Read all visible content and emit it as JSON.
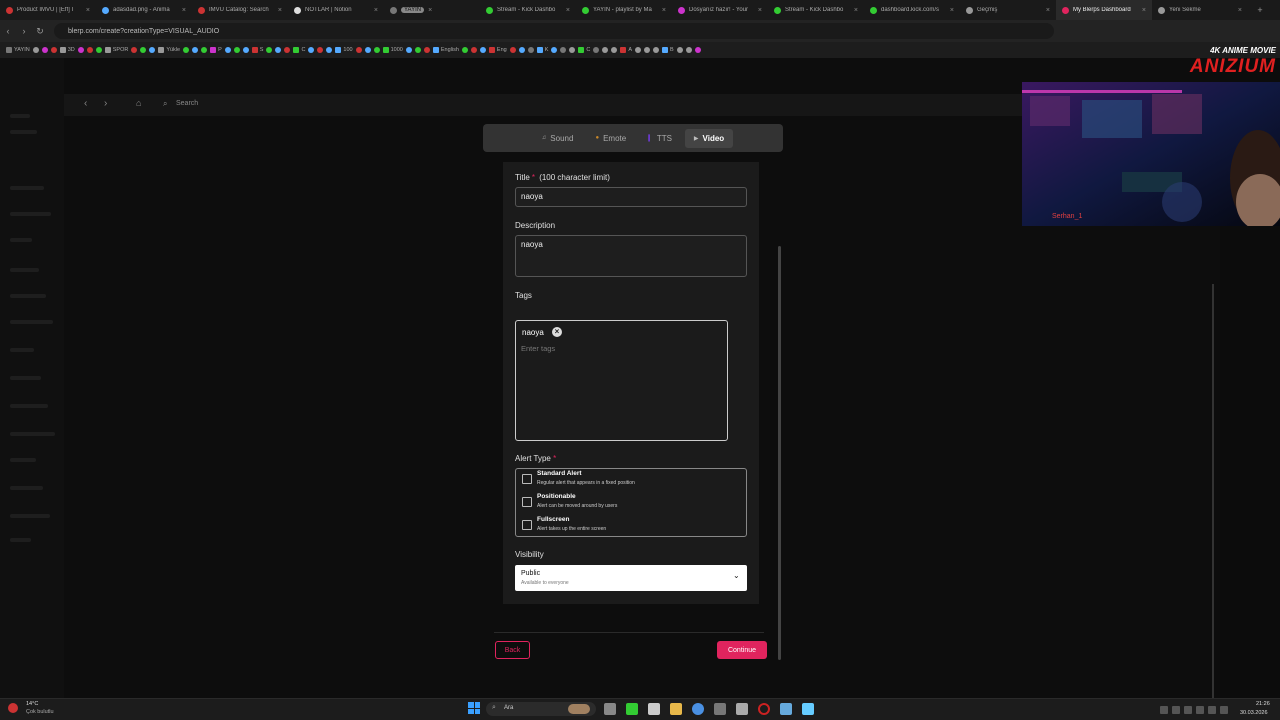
{
  "browser": {
    "tabs": [
      {
        "title": "Product IMVU | [Eff] I",
        "color": "#c33",
        "active": false
      },
      {
        "title": "adasdad.png - Anima",
        "color": "#5af",
        "active": false
      },
      {
        "title": "IMVU Catalog: Search",
        "color": "#c33",
        "active": false
      },
      {
        "title": "NOTLAR | Notion",
        "color": "#ddd",
        "active": false
      },
      {
        "title": "YAYIN",
        "color": "#777",
        "active": false,
        "badge": true
      },
      {
        "title": "Stream - Kick Dashbo",
        "color": "#3c3",
        "active": false
      },
      {
        "title": "YAYIN - playlist by Ma",
        "color": "#3c3",
        "active": false
      },
      {
        "title": "Dosyanız hazır! - Your",
        "color": "#c3c",
        "active": false
      },
      {
        "title": "Stream - Kick Dashbo",
        "color": "#3c3",
        "active": false
      },
      {
        "title": "dashboard.kick.com/s",
        "color": "#3c3",
        "active": false
      },
      {
        "title": "Geçmiş",
        "color": "#999",
        "active": false
      },
      {
        "title": "My Blerps Dashboard",
        "color": "#e0245e",
        "active": true
      },
      {
        "title": "Yeni Sekme",
        "color": "#999",
        "active": false
      }
    ],
    "url": "blerp.com/create?creationType=VISUAL_AUDIO",
    "bookmarks": [
      "YAYIN",
      "3D",
      "SPOR",
      "Yükle",
      "P",
      "S",
      "C",
      "100",
      "1000",
      "English",
      "Eng",
      "K",
      "C",
      "A",
      "B"
    ]
  },
  "page": {
    "search_placeholder": "Search",
    "type_tabs": [
      {
        "label": "Sound",
        "icon": "music-note-icon",
        "active": false
      },
      {
        "label": "Emote",
        "icon": "emote-icon",
        "active": false
      },
      {
        "label": "TTS",
        "icon": "tts-icon",
        "active": false
      },
      {
        "label": "Video",
        "icon": "video-icon",
        "active": true
      }
    ],
    "form": {
      "title_label": "Title",
      "title_required": "*",
      "title_limit": "(100 character limit)",
      "title_value": "naoya",
      "description_label": "Description",
      "description_value": "naoya",
      "tags_label": "Tags",
      "tag_chip": "naoya",
      "tags_placeholder": "Enter tags",
      "alert_type_label": "Alert Type",
      "alert_options": [
        {
          "title": "Standard Alert",
          "desc": "Regular alert that appears in a fixed position",
          "checked": false
        },
        {
          "title": "Positionable",
          "desc": "Alert can be moved around by users",
          "checked": false
        },
        {
          "title": "Fullscreen",
          "desc": "Alert takes up the entire screen",
          "checked": false
        }
      ],
      "visibility_label": "Visibility",
      "visibility_value": "Public",
      "visibility_desc": "Available to everyone"
    },
    "back_label": "Back",
    "continue_label": "Continue"
  },
  "overlay": {
    "logo_line1": "4K ANIME MOVIE",
    "logo_line2": "ANIZIUM",
    "webcam_user": "Serhan_1"
  },
  "taskbar": {
    "weather_temp": "14°C",
    "weather_desc": "Çok bulutlu",
    "search_label": "Ara",
    "time": "21:26",
    "date": "30.03.2026"
  },
  "colors": {
    "accent": "#e0245e"
  }
}
